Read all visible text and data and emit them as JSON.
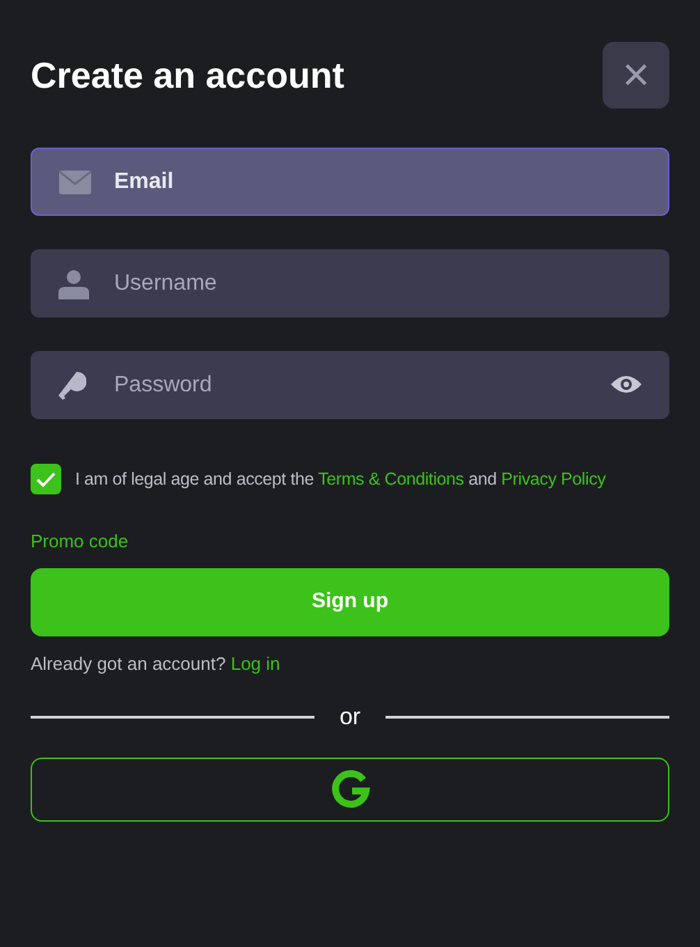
{
  "title": "Create an account",
  "close_button": {
    "symbol": "×"
  },
  "fields": [
    {
      "kind": "email",
      "placeholder": "Email",
      "focused": true
    },
    {
      "kind": "username",
      "placeholder": "Username",
      "focused": false
    },
    {
      "kind": "password",
      "placeholder": "Password",
      "focused": false
    }
  ],
  "agreement": {
    "checked": true,
    "text_before": "I am of legal age and accept the",
    "terms_link": "Terms & Conditions",
    "joiner": "and",
    "privacy_link": "Privacy Policy"
  },
  "promo_link": "Promo code",
  "signup_button": "Sign up",
  "login_prompt": {
    "text": "Already got an account?",
    "link": "Log in"
  },
  "divider_label": "or"
}
